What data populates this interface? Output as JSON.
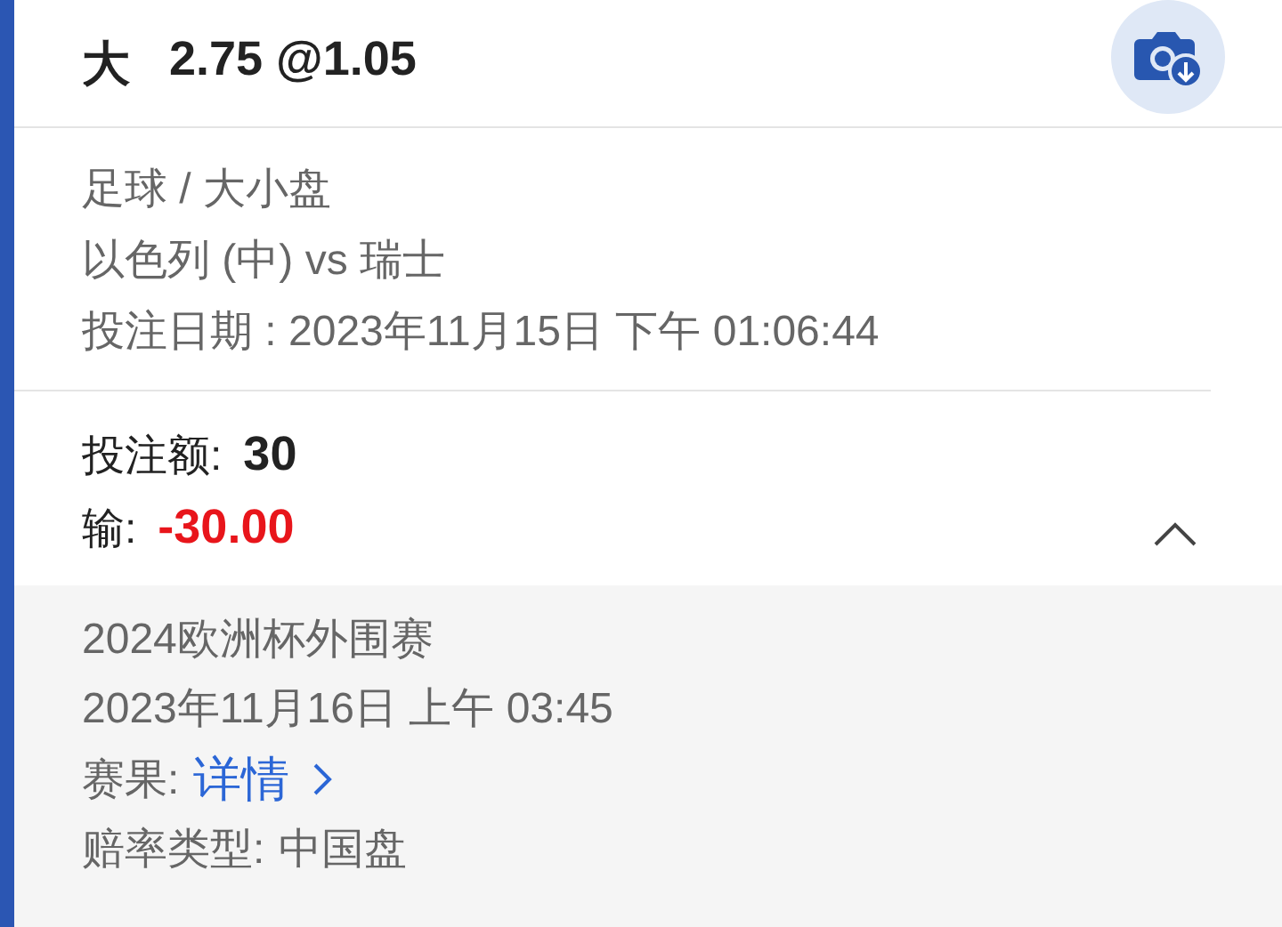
{
  "bet": {
    "selection": "大",
    "line": "2.75 @1.05"
  },
  "details": [
    "足球 / 大小盘",
    "以色列 (中) vs 瑞士",
    "投注日期 : 2023年11月15日 下午 01:06:44"
  ],
  "stake": {
    "label": "投注额:",
    "value": "30"
  },
  "result": {
    "label": "输:",
    "value": "-30.00"
  },
  "expanded": true,
  "extra": {
    "event": "2024欧洲杯外围赛",
    "date": "2023年11月16日 上午 03:45",
    "result_label": "赛果:",
    "result_link": "详情",
    "odds_label": "赔率类型:",
    "odds_value": "中国盘"
  }
}
